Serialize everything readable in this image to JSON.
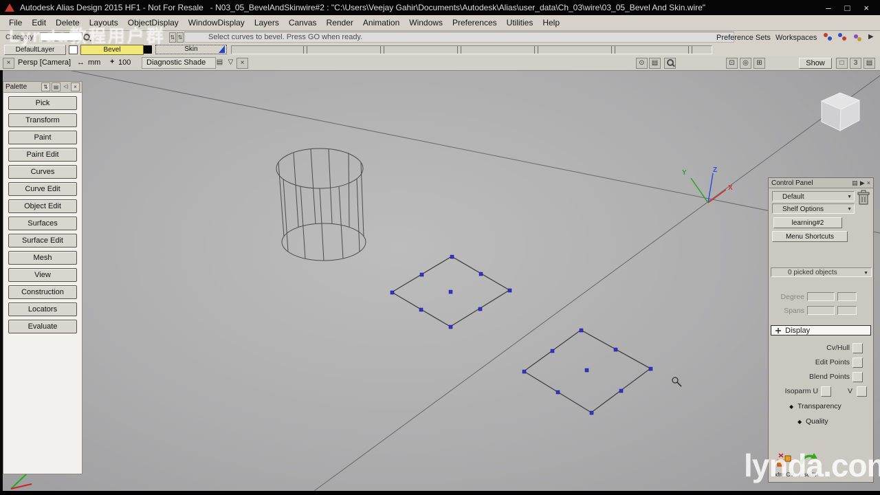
{
  "title_bar": {
    "app_title": "Autodesk Alias Design 2015 HF1 - Not For Resale",
    "doc_title": "- N03_05_BevelAndSkinwire#2 : \"C:\\Users\\Veejay Gahir\\Documents\\Autodesk\\Alias\\user_data\\Ch_03\\wire\\03_05_Bevel And Skin.wire\""
  },
  "menu_bar": {
    "items": [
      "File",
      "Edit",
      "Delete",
      "Layouts",
      "ObjectDisplay",
      "WindowDisplay",
      "Layers",
      "Canvas",
      "Render",
      "Animation",
      "Windows",
      "Preferences",
      "Utilities",
      "Help"
    ]
  },
  "prompt_bar": {
    "category_label": "Category",
    "search_value": "",
    "prompt_text": "Select curves to bevel. Press GO when ready.",
    "preference_sets_label": "Preference Sets",
    "workspaces_label": "Workspaces"
  },
  "layer_bar": {
    "default_layer_label": "DefaultLayer",
    "bevel_label": "Bevel",
    "skin_label": "Skin"
  },
  "viewport_header": {
    "camera_label": "Persp [Camera]",
    "units_label": "mm",
    "zoom_value": "100",
    "shade_tab_label": "Diagnostic Shade",
    "show_button_label": "Show",
    "frame_value": "3"
  },
  "palette": {
    "title": "Palette",
    "items": [
      "Pick",
      "Transform",
      "Paint",
      "Paint Edit",
      "Curves",
      "Curve Edit",
      "Object Edit",
      "Surfaces",
      "Surface Edit",
      "Mesh",
      "View",
      "Construction",
      "Locators",
      "Evaluate"
    ]
  },
  "viewport": {
    "axis_x": "X",
    "axis_y": "Y",
    "axis_z": "Z"
  },
  "control_panel": {
    "title": "Control Panel",
    "shelf_select_value": "Default",
    "shelf_options_value": "Shelf Options",
    "shelf_tab_label": "learning#2",
    "menu_shortcuts_label": "Menu Shortcuts",
    "picked_objects_text": "0 picked objects",
    "degree_label": "Degree",
    "spans_label": "Spans",
    "display_header_label": "Display",
    "cv_hull_label": "Cv/Hull",
    "edit_points_label": "Edit Points",
    "blend_points_label": "Blend Points",
    "isoparm_u_label": "Isoparm U",
    "isoparm_v_label": "V",
    "transparency_label": "Transparency",
    "quality_label": "Quality",
    "tool_xfrmcv_label": "xfrmCV",
    "tool_xsedit_label": "xsedit"
  },
  "watermarks": {
    "lynda": "lynda.com",
    "overlay_text": "Lynda教程用户群"
  },
  "icons": {
    "minimize": "–",
    "maximize": "□",
    "close": "×",
    "dropdown": "▼",
    "right_arrow": "▶",
    "resize_h": "↔",
    "crosshair": "+",
    "sheet": "▤",
    "swap": "⇅",
    "tri_left": "◁",
    "tri_down": "▽",
    "circle_dot": "⊙",
    "grid": "⊞",
    "box_dot": "⊡",
    "circle": "◎",
    "dash_box": "□",
    "diamond": "◆"
  },
  "colors": {
    "bevel_layer": "#f2e87a",
    "axis_x": "#d03434",
    "axis_y": "#2ba32b",
    "axis_z": "#2f4fd6",
    "edit_point": "#3333cc"
  }
}
